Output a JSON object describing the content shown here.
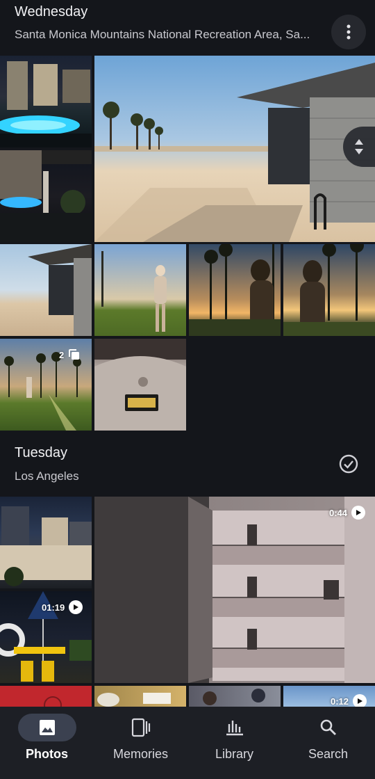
{
  "sections": [
    {
      "title": "Wednesday",
      "subtitle": "Santa Monica Mountains National Recreation Area, Sa..."
    },
    {
      "title": "Tuesday",
      "subtitle": "Los Angeles"
    }
  ],
  "wednesday_photos": {
    "group_count": "2"
  },
  "tuesday_videos": {
    "duration_1": "0:44",
    "duration_2": "01:19",
    "duration_3": "0:12"
  },
  "nav": {
    "items": [
      {
        "label": "Photos",
        "icon": "photo-icon",
        "active": true
      },
      {
        "label": "Memories",
        "icon": "memories-icon",
        "active": false
      },
      {
        "label": "Library",
        "icon": "library-icon",
        "active": false
      },
      {
        "label": "Search",
        "icon": "search-icon",
        "active": false
      }
    ]
  },
  "colors": {
    "background": "#14161b",
    "nav_background": "#1d1f25",
    "active_pill": "#3b4150"
  }
}
